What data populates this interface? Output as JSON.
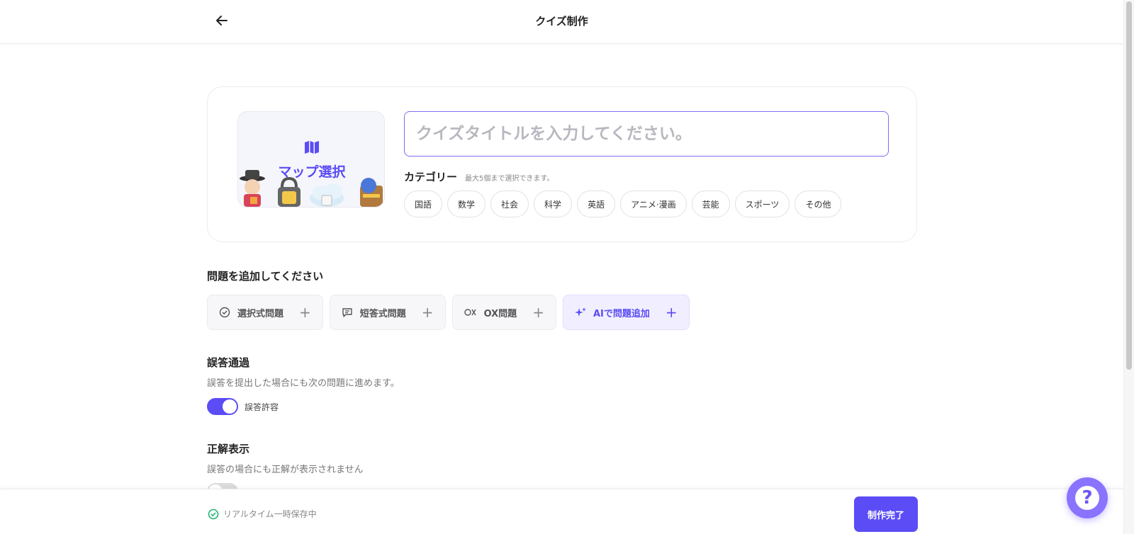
{
  "header": {
    "title": "クイズ制作"
  },
  "map_select": {
    "label": "マップ選択"
  },
  "title_input": {
    "placeholder": "クイズタイトルを入力してください。",
    "value": ""
  },
  "category": {
    "label": "カテゴリー",
    "hint": "最大5個まで選択できます。",
    "chips": [
      "国語",
      "数学",
      "社会",
      "科学",
      "英語",
      "アニメ·漫画",
      "芸能",
      "スポーツ",
      "その他"
    ]
  },
  "add_question": {
    "title": "問題を追加してください",
    "buttons": [
      {
        "label": "選択式問題",
        "icon": "check-circle-icon"
      },
      {
        "label": "短答式問題",
        "icon": "message-icon"
      },
      {
        "label": "OX問題",
        "icon": "ox-icon"
      },
      {
        "label": "AIで問題追加",
        "icon": "sparkle-icon"
      }
    ]
  },
  "wrong_pass": {
    "title": "誤答通過",
    "description": "誤答を提出した場合にも次の問題に進めます。",
    "toggle_label": "誤答許容",
    "enabled": true
  },
  "show_answer": {
    "title": "正解表示",
    "description": "誤答の場合にも正解が表示されません",
    "enabled": false
  },
  "footer": {
    "save_status": "リアルタイム一時保存中",
    "finish_label": "制作完了"
  },
  "colors": {
    "accent": "#5b4cf5",
    "success": "#22b573"
  }
}
